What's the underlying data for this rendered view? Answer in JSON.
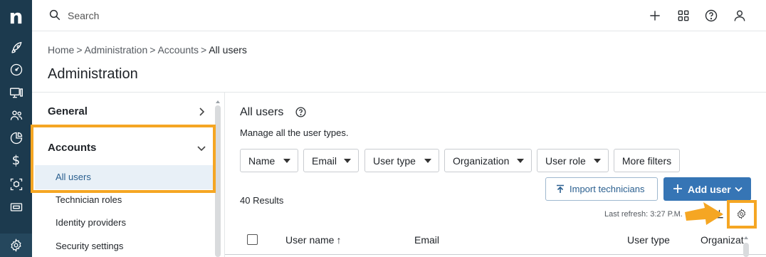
{
  "rail": {
    "logo": "n",
    "icons": [
      "rocket-icon",
      "dashboard-gauge-icon",
      "devices-icon",
      "users-icon",
      "pie-chart-icon",
      "dollar-icon",
      "scan-cube-icon",
      "ticket-icon",
      "settings-gear-icon"
    ],
    "dollar": "$"
  },
  "topbar": {
    "search_placeholder": "Search",
    "icons": [
      "plus-icon",
      "apps-grid-icon",
      "help-icon",
      "user-icon"
    ]
  },
  "breadcrumb": {
    "items": [
      "Home",
      "Administration",
      "Accounts"
    ],
    "separator": ">",
    "current": "All users"
  },
  "page_title": "Administration",
  "leftnav": {
    "general": "General",
    "accounts": "Accounts",
    "items": [
      "All users",
      "Technician roles",
      "Identity providers",
      "Security settings"
    ],
    "active_index": 0
  },
  "content": {
    "title": "All users",
    "description": "Manage all the user types.",
    "filters": [
      "Name",
      "Email",
      "User type",
      "Organization",
      "User role"
    ],
    "more_filters": "More filters",
    "results": "40 Results",
    "import_button": "Import technicians",
    "add_button": "Add user",
    "refresh": "Last refresh: 3:27 P.M.",
    "columns": [
      "User name",
      "Email",
      "User type",
      "Organizat"
    ],
    "sort_indicator": "↑"
  },
  "colors": {
    "rail_bg": "#1c3a4e",
    "accent": "#3675b5",
    "highlight": "#f5a623",
    "active_bg": "#e8f0f7"
  }
}
